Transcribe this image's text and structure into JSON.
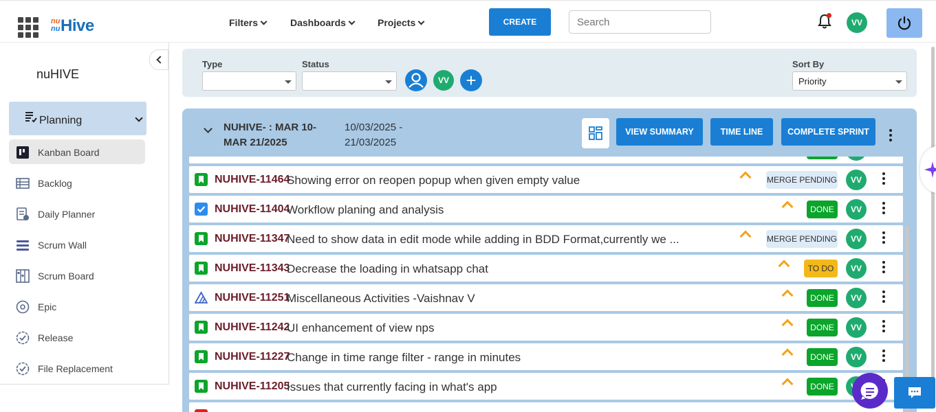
{
  "header": {
    "logo_prefix": "nu",
    "logo_text": "Hive",
    "nav": [
      "Filters",
      "Dashboards",
      "Projects"
    ],
    "create_label": "CREATE",
    "search_placeholder": "Search",
    "user_initials": "VV"
  },
  "sidebar": {
    "title": "nuHIVE",
    "group_label": "Planning",
    "items": [
      {
        "label": "Kanban Board",
        "icon": "kanban-icon",
        "active": true
      },
      {
        "label": "Backlog",
        "icon": "backlog-icon"
      },
      {
        "label": "Daily Planner",
        "icon": "daily-planner-icon"
      },
      {
        "label": "Scrum Wall",
        "icon": "scrum-wall-icon"
      },
      {
        "label": "Scrum Board",
        "icon": "scrum-board-icon"
      },
      {
        "label": "Epic",
        "icon": "epic-icon"
      },
      {
        "label": "Release",
        "icon": "release-icon"
      },
      {
        "label": "File Replacement",
        "icon": "file-replacement-icon"
      }
    ]
  },
  "filters": {
    "type_label": "Type",
    "type_value": "",
    "status_label": "Status",
    "status_value": "",
    "member_initials": "VV",
    "sort_label": "Sort By",
    "sort_value": "Priority"
  },
  "sprint": {
    "name": "NUHIVE- : MAR 10-MAR 21/2025",
    "dates": "10/03/2025 - 21/03/2025",
    "view_summary_label": "VIEW SUMMARY",
    "timeline_label": "TIME LINE",
    "complete_label": "COMPLETE SPRINT"
  },
  "issues": [
    {
      "key": "NUHIVE-11464",
      "title": "Showing error on reopen popup when given empty value",
      "type": "story",
      "status": "MERGE PENDING",
      "assignee": "VV"
    },
    {
      "key": "NUHIVE-11404",
      "title": "Workflow planing and analysis",
      "type": "task",
      "status": "DONE",
      "assignee": "VV"
    },
    {
      "key": "NUHIVE-11347",
      "title": "Need to show data in edit mode while adding in BDD Format,currently we ...",
      "type": "story",
      "status": "MERGE PENDING",
      "assignee": "VV"
    },
    {
      "key": "NUHIVE-11343",
      "title": "Decrease the loading in whatsapp chat",
      "type": "story",
      "status": "TO DO",
      "assignee": "VV"
    },
    {
      "key": "NUHIVE-11251",
      "title": "Miscellaneous Activities -Vaishnav V",
      "type": "epic",
      "status": "DONE",
      "assignee": "VV"
    },
    {
      "key": "NUHIVE-11242",
      "title": "UI enhancement of view nps",
      "type": "story",
      "status": "DONE",
      "assignee": "VV"
    },
    {
      "key": "NUHIVE-11227",
      "title": "Change in time range filter - range in minutes",
      "type": "story",
      "status": "DONE",
      "assignee": "VV"
    },
    {
      "key": "NUHIVE-11205",
      "title": "Issues that currently facing in what's app",
      "type": "story",
      "status": "DONE",
      "assignee": "VV"
    }
  ],
  "colors": {
    "primary": "#1a7fd4",
    "done": "#0aa52a",
    "todo": "#f3b91a",
    "merge_pending": "#ddeaf7",
    "priority_arrow": "#f3a21b",
    "story_icon": "#0aa52a",
    "task_icon": "#2d8cf0"
  }
}
